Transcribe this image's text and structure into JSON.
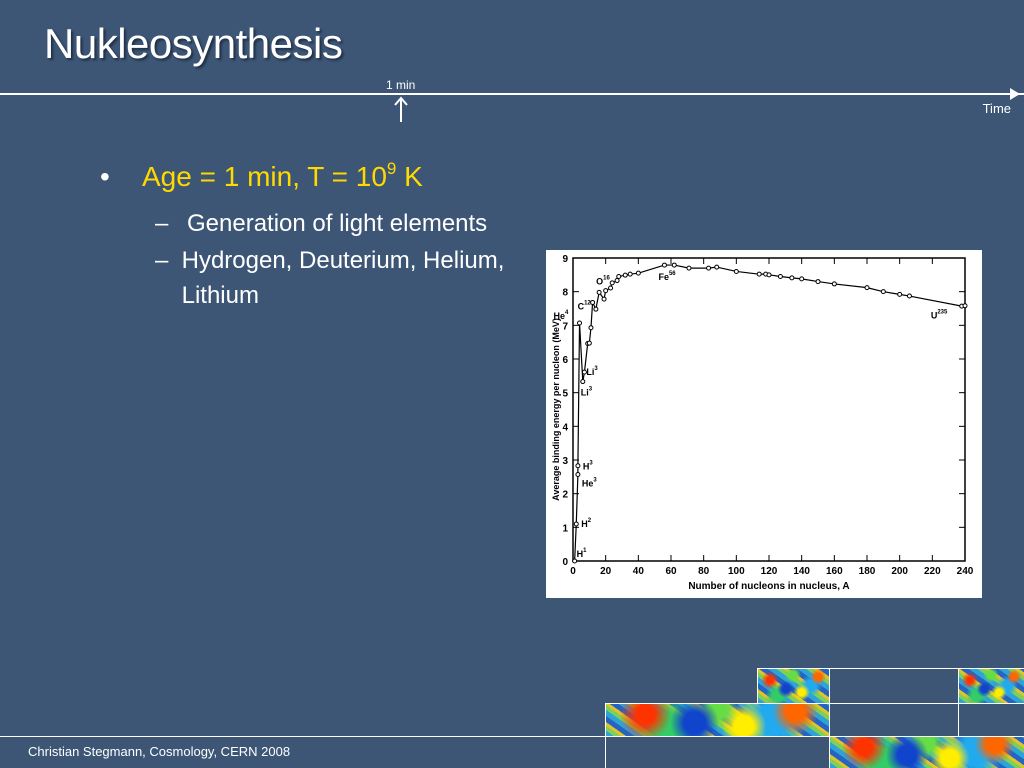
{
  "slide": {
    "title": "Nukleosynthesis",
    "timeline": {
      "marker_label": "1 min",
      "axis_label": "Time"
    },
    "bullet": {
      "text_before": "Age = 1 min, T = 10",
      "superscript": "9",
      "text_after": " K"
    },
    "sub_bullets": [
      "Generation of light elements",
      "Hydrogen, Deuterium, Helium, Lithium"
    ],
    "footer": "Christian Stegmann, Cosmology, CERN 2008",
    "colors": {
      "background": "#3d5676",
      "bullet_accent": "#ffd900",
      "text": "#ffffff"
    }
  },
  "chart_data": {
    "type": "line",
    "xlabel": "Number of nucleons in nucleus, A",
    "ylabel": "Average binding energy per nucleon (MeV)",
    "xlim": [
      0,
      240
    ],
    "ylim": [
      0,
      9
    ],
    "x_ticks": [
      0,
      20,
      40,
      60,
      80,
      100,
      120,
      140,
      160,
      180,
      200,
      220,
      240
    ],
    "y_ticks": [
      0,
      1,
      2,
      3,
      4,
      5,
      6,
      7,
      8,
      9
    ],
    "series": [
      {
        "x": [
          1,
          2,
          3,
          3,
          4,
          6,
          7,
          9,
          10,
          11,
          12,
          14,
          16,
          19,
          20,
          23,
          24,
          27,
          28,
          32,
          35,
          40,
          56,
          62,
          71,
          83,
          88,
          100,
          114,
          118,
          120,
          127,
          134,
          140,
          150,
          160,
          180,
          190,
          200,
          206,
          238,
          240
        ],
        "y": [
          0,
          1.1,
          2.57,
          2.83,
          7.07,
          5.33,
          5.61,
          6.46,
          6.47,
          6.93,
          7.68,
          7.48,
          7.98,
          7.78,
          8.03,
          8.11,
          8.26,
          8.33,
          8.45,
          8.49,
          8.52,
          8.55,
          8.79,
          8.79,
          8.7,
          8.7,
          8.73,
          8.6,
          8.52,
          8.52,
          8.5,
          8.45,
          8.41,
          8.38,
          8.3,
          8.23,
          8.12,
          8.0,
          7.92,
          7.87,
          7.57,
          7.58
        ]
      }
    ],
    "annotations": [
      {
        "label": "H",
        "sup": "1",
        "x": 1,
        "y": 0
      },
      {
        "label": "H",
        "sup": "2",
        "x": 2,
        "y": 1.1
      },
      {
        "label": "He",
        "sup": "3",
        "x": 3,
        "y": 2.57
      },
      {
        "label": "H",
        "sup": "3",
        "x": 3,
        "y": 2.83
      },
      {
        "label": "Li",
        "sup": "3",
        "x": 6,
        "y": 5.33
      },
      {
        "label": "Li",
        "sup": "3",
        "x": 7,
        "y": 5.61
      },
      {
        "label": "He",
        "sup": "4",
        "x": 4,
        "y": 7.07
      },
      {
        "label": "C",
        "sup": "12",
        "x": 12,
        "y": 7.68
      },
      {
        "label": "O",
        "sup": "16",
        "x": 16,
        "y": 7.98
      },
      {
        "label": "Fe",
        "sup": "56",
        "x": 56,
        "y": 8.79
      },
      {
        "label": "U",
        "sup": "235",
        "x": 235,
        "y": 7.59
      }
    ]
  }
}
